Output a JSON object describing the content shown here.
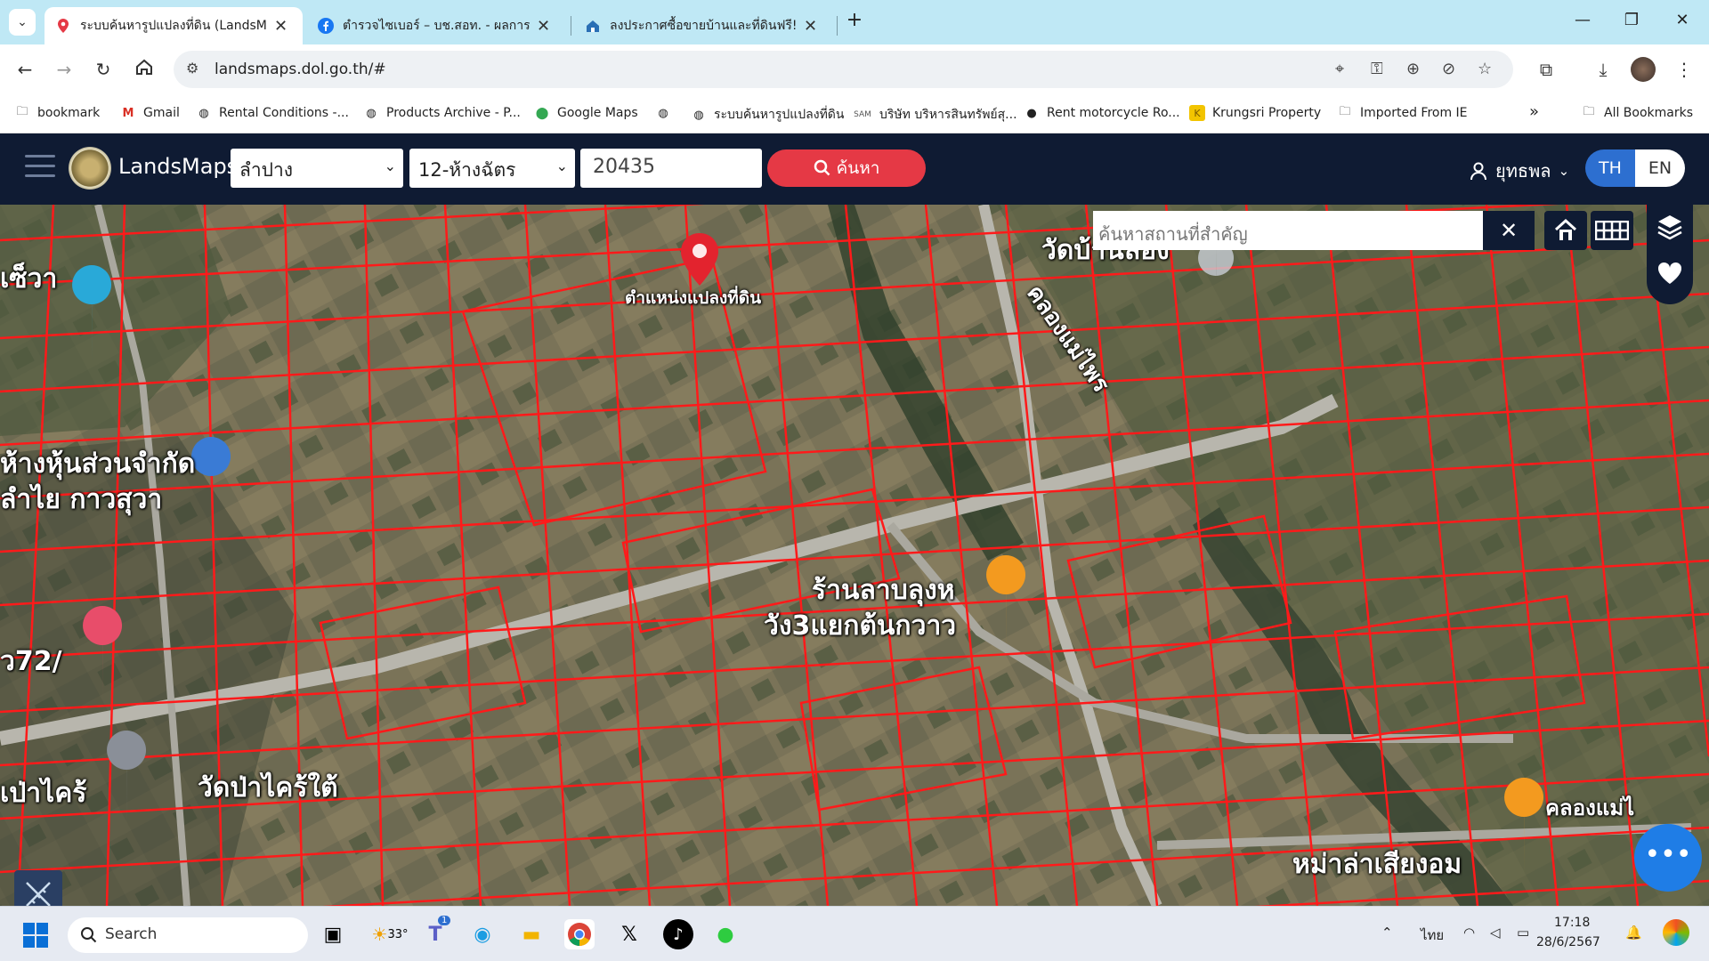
{
  "browser": {
    "tabs": [
      {
        "title": "ระบบค้นหารูปแปลงที่ดิน (LandsMap",
        "active": true,
        "icon": "map-pin-icon"
      },
      {
        "title": "ตำรวจไซเบอร์ – บช.สอท. - ผลการค้",
        "active": false,
        "icon": "facebook-icon"
      },
      {
        "title": "ลงประกาศซื้อขายบ้านและที่ดินฟรี! | ",
        "active": false,
        "icon": "house-icon"
      }
    ],
    "new_tab": "+",
    "url": "landsmaps.dol.go.th/#",
    "bookmarks": [
      {
        "label": "bookmark",
        "icon": "folder-icon"
      },
      {
        "label": "Gmail",
        "icon": "gmail-icon"
      },
      {
        "label": "Rental Conditions -...",
        "icon": "globe-icon"
      },
      {
        "label": "Products Archive - P...",
        "icon": "globe-icon"
      },
      {
        "label": "Google Maps",
        "icon": "google-maps-icon"
      },
      {
        "label": "",
        "icon": "globe-icon"
      },
      {
        "label": "ระบบค้นหารูปแปลงที่ดิน",
        "icon": "globe-icon"
      },
      {
        "label": "บริษัท บริหารสินทรัพย์สุ...",
        "icon": "sam-icon"
      },
      {
        "label": "Rent motorcycle Ro...",
        "icon": "motorcycle-icon"
      },
      {
        "label": "Krungsri Property",
        "icon": "krungsri-icon"
      },
      {
        "label": "Imported From IE",
        "icon": "folder-icon"
      }
    ],
    "more_bookmarks": "»",
    "all_bookmarks": "All Bookmarks"
  },
  "app": {
    "brand": "LandsMaps",
    "province": "ลำปาง",
    "district": "12-ห้างฉัตร",
    "parcel_number": "20435",
    "search_label": "ค้นหา",
    "user_name": "ยุทธพล",
    "lang_th": "TH",
    "lang_en": "EN",
    "place_search_placeholder": "ค้นหาสถานที่สำคัญ"
  },
  "map": {
    "pin_label": "ตำแหน่งแปลงที่ดิน",
    "labels": [
      {
        "text": "วัดบ้านล้อง"
      },
      {
        "text": "คลองแม่ไพร"
      },
      {
        "text": "ห้างหุ้นส่วนจำกัด"
      },
      {
        "text": "ลำไย กาวสุวา"
      },
      {
        "text": "เซ็วา"
      },
      {
        "text": "ร้านลาบลุงห"
      },
      {
        "text": "วัง3แยกต้นกวาว"
      },
      {
        "text": "วัดป่าไคร้ใต้"
      },
      {
        "text": "เป่าไคร้"
      },
      {
        "text": "ว72/"
      },
      {
        "text": "หม่าล่าเสียงอม"
      },
      {
        "text": "คลองแม่ไ"
      }
    ]
  },
  "taskbar": {
    "search_label": "Search",
    "weather": "33°",
    "teams_badge": "1",
    "language": "ไทย",
    "time": "17:18",
    "date": "28/6/2567"
  }
}
